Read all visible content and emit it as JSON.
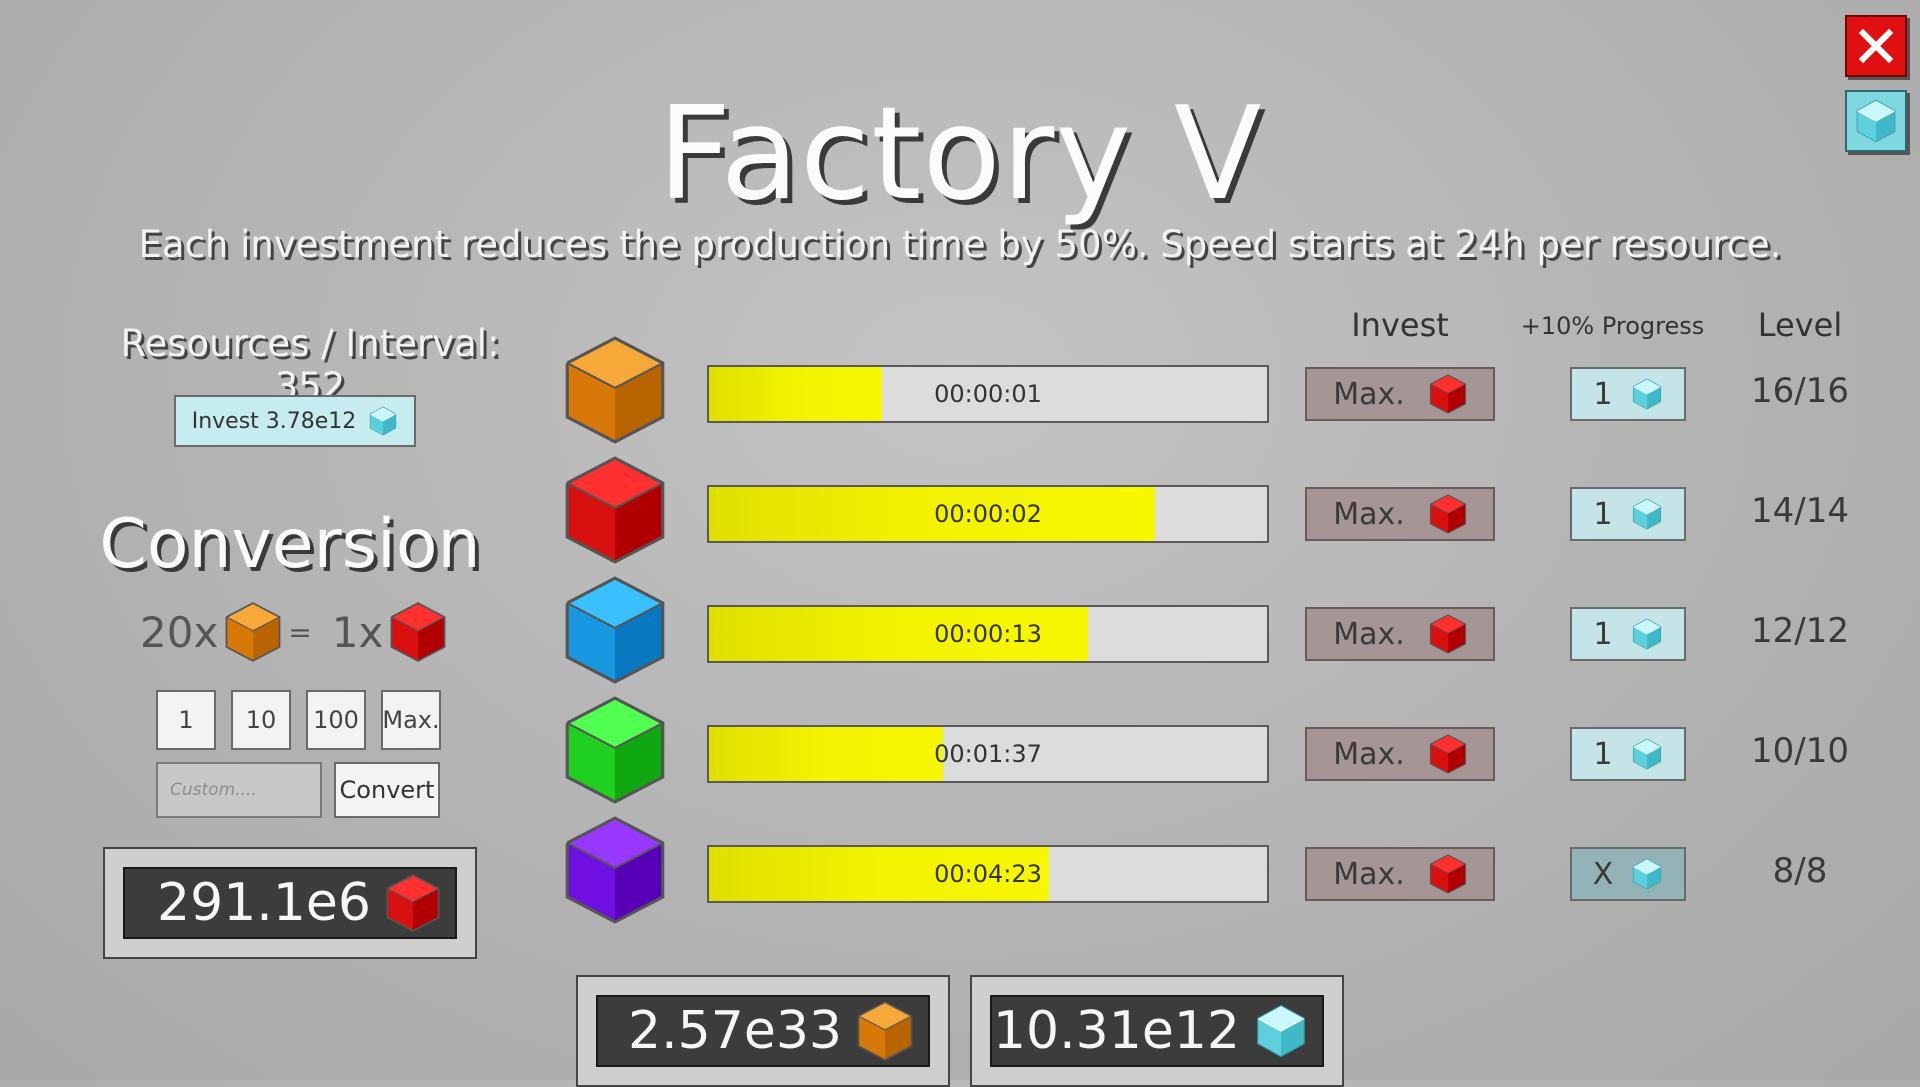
{
  "title": "Factory V",
  "subtitle": "Each investment reduces the production time by 50%. Speed starts at 24h per resource.",
  "resources_interval": "Resources / Interval: 352",
  "invest_resources_label": "Invest 3.78e12",
  "conversion": {
    "title": "Conversion",
    "from_amount": "20x",
    "equals": "=",
    "to_amount": "1x",
    "amount_buttons": [
      "1",
      "10",
      "100",
      "Max."
    ],
    "custom_placeholder": "Custom....",
    "convert_label": "Convert"
  },
  "red_cube_total": "291.1e6",
  "columns": {
    "invest": "Invest",
    "progress": "+10% Progress",
    "level": "Level"
  },
  "rows": [
    {
      "cube": "orange-cube-icon",
      "timer": "00:00:01",
      "progress": 0.31,
      "invest_label": "Max.",
      "progress_label": "1",
      "level": "16/16",
      "progress_enabled": true
    },
    {
      "cube": "red-cube-icon",
      "timer": "00:00:02",
      "progress": 0.8,
      "invest_label": "Max.",
      "progress_label": "1",
      "level": "14/14",
      "progress_enabled": true
    },
    {
      "cube": "blue-cube-icon",
      "timer": "00:00:13",
      "progress": 0.68,
      "invest_label": "Max.",
      "progress_label": "1",
      "level": "12/12",
      "progress_enabled": true
    },
    {
      "cube": "green-cube-icon",
      "timer": "00:01:37",
      "progress": 0.42,
      "invest_label": "Max.",
      "progress_label": "1",
      "level": "10/10",
      "progress_enabled": true
    },
    {
      "cube": "purple-cube-icon",
      "timer": "00:04:23",
      "progress": 0.61,
      "invest_label": "Max.",
      "progress_label": "X",
      "level": "8/8",
      "progress_enabled": false
    }
  ],
  "orange_cube_total": "2.57e33",
  "gem_total": "10.31e12",
  "colors": {
    "orange": "#f09018",
    "red": "#e81818",
    "blue": "#2aa8f0",
    "green": "#30e830",
    "purple": "#7818e8",
    "bar_fill": "#f3f300",
    "close": "#e01010",
    "gem": "#7fd8e0"
  }
}
